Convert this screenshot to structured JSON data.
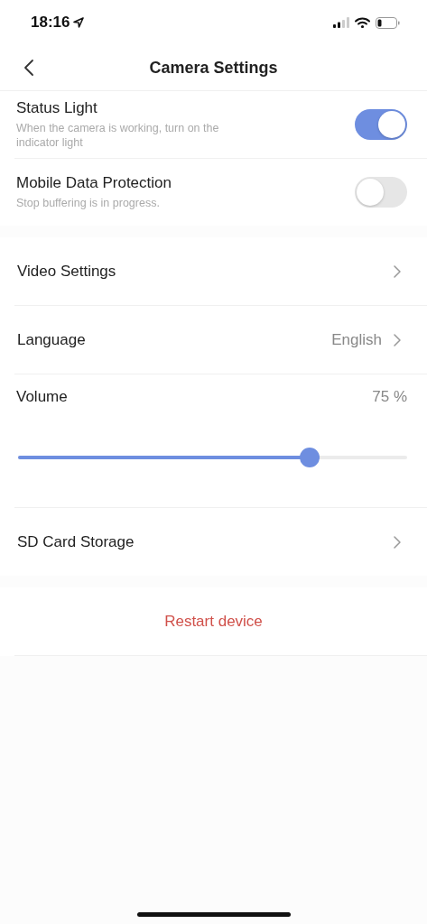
{
  "status_bar": {
    "time": "18:16"
  },
  "nav_bar": {
    "title": "Camera Settings"
  },
  "groups": [
    {
      "items": [
        {
          "kind": "toggle",
          "label": "Status Light",
          "description": "When the camera is working, turn on the indicator light",
          "on": true
        },
        {
          "kind": "toggle",
          "label": "Mobile Data Protection",
          "description": "Stop buffering is in progress.",
          "on": false
        }
      ]
    },
    {
      "items": [
        {
          "kind": "link",
          "label": "Video Settings"
        },
        {
          "kind": "link",
          "label": "Language",
          "value": "English"
        },
        {
          "kind": "slider",
          "label": "Volume",
          "reading": "75 %",
          "level": 0.75
        },
        {
          "kind": "link",
          "label": "SD Card Storage"
        }
      ]
    },
    {
      "items": [
        {
          "kind": "action",
          "label": "Restart device"
        }
      ]
    }
  ]
}
